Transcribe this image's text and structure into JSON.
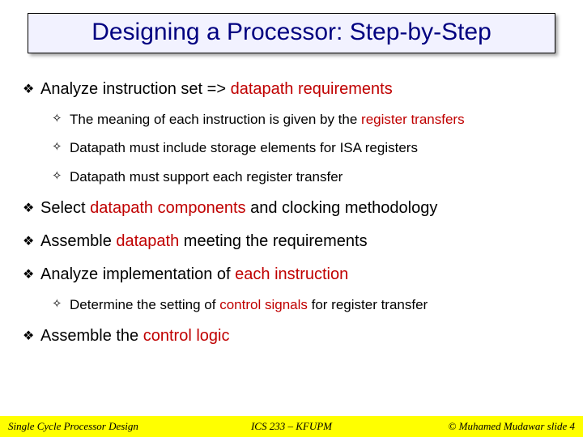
{
  "title": "Designing a Processor: Step-by-Step",
  "bullets": {
    "b1_pre": "Analyze instruction set => ",
    "b1_hl": "datapath requirements",
    "b1a_pre": "The meaning of each instruction is given by the ",
    "b1a_hl": "register transfers",
    "b1b": "Datapath must include storage elements for ISA registers",
    "b1c": "Datapath must support each register transfer",
    "b2_pre": "Select ",
    "b2_hl": "datapath components",
    "b2_post": " and clocking methodology",
    "b3_pre": "Assemble ",
    "b3_hl": "datapath",
    "b3_post": " meeting the requirements",
    "b4_pre": "Analyze implementation of ",
    "b4_hl": "each instruction",
    "b4a_pre": "Determine the setting of ",
    "b4a_hl": "control signals",
    "b4a_post": " for register transfer",
    "b5_pre": "Assemble the ",
    "b5_hl": "control logic"
  },
  "footer": {
    "left": "Single Cycle Processor Design",
    "center": "ICS 233 – KFUPM",
    "right": "© Muhamed Mudawar  slide 4"
  },
  "glyphs": {
    "diamond_filled": "❖",
    "diamond_open": "✧"
  }
}
